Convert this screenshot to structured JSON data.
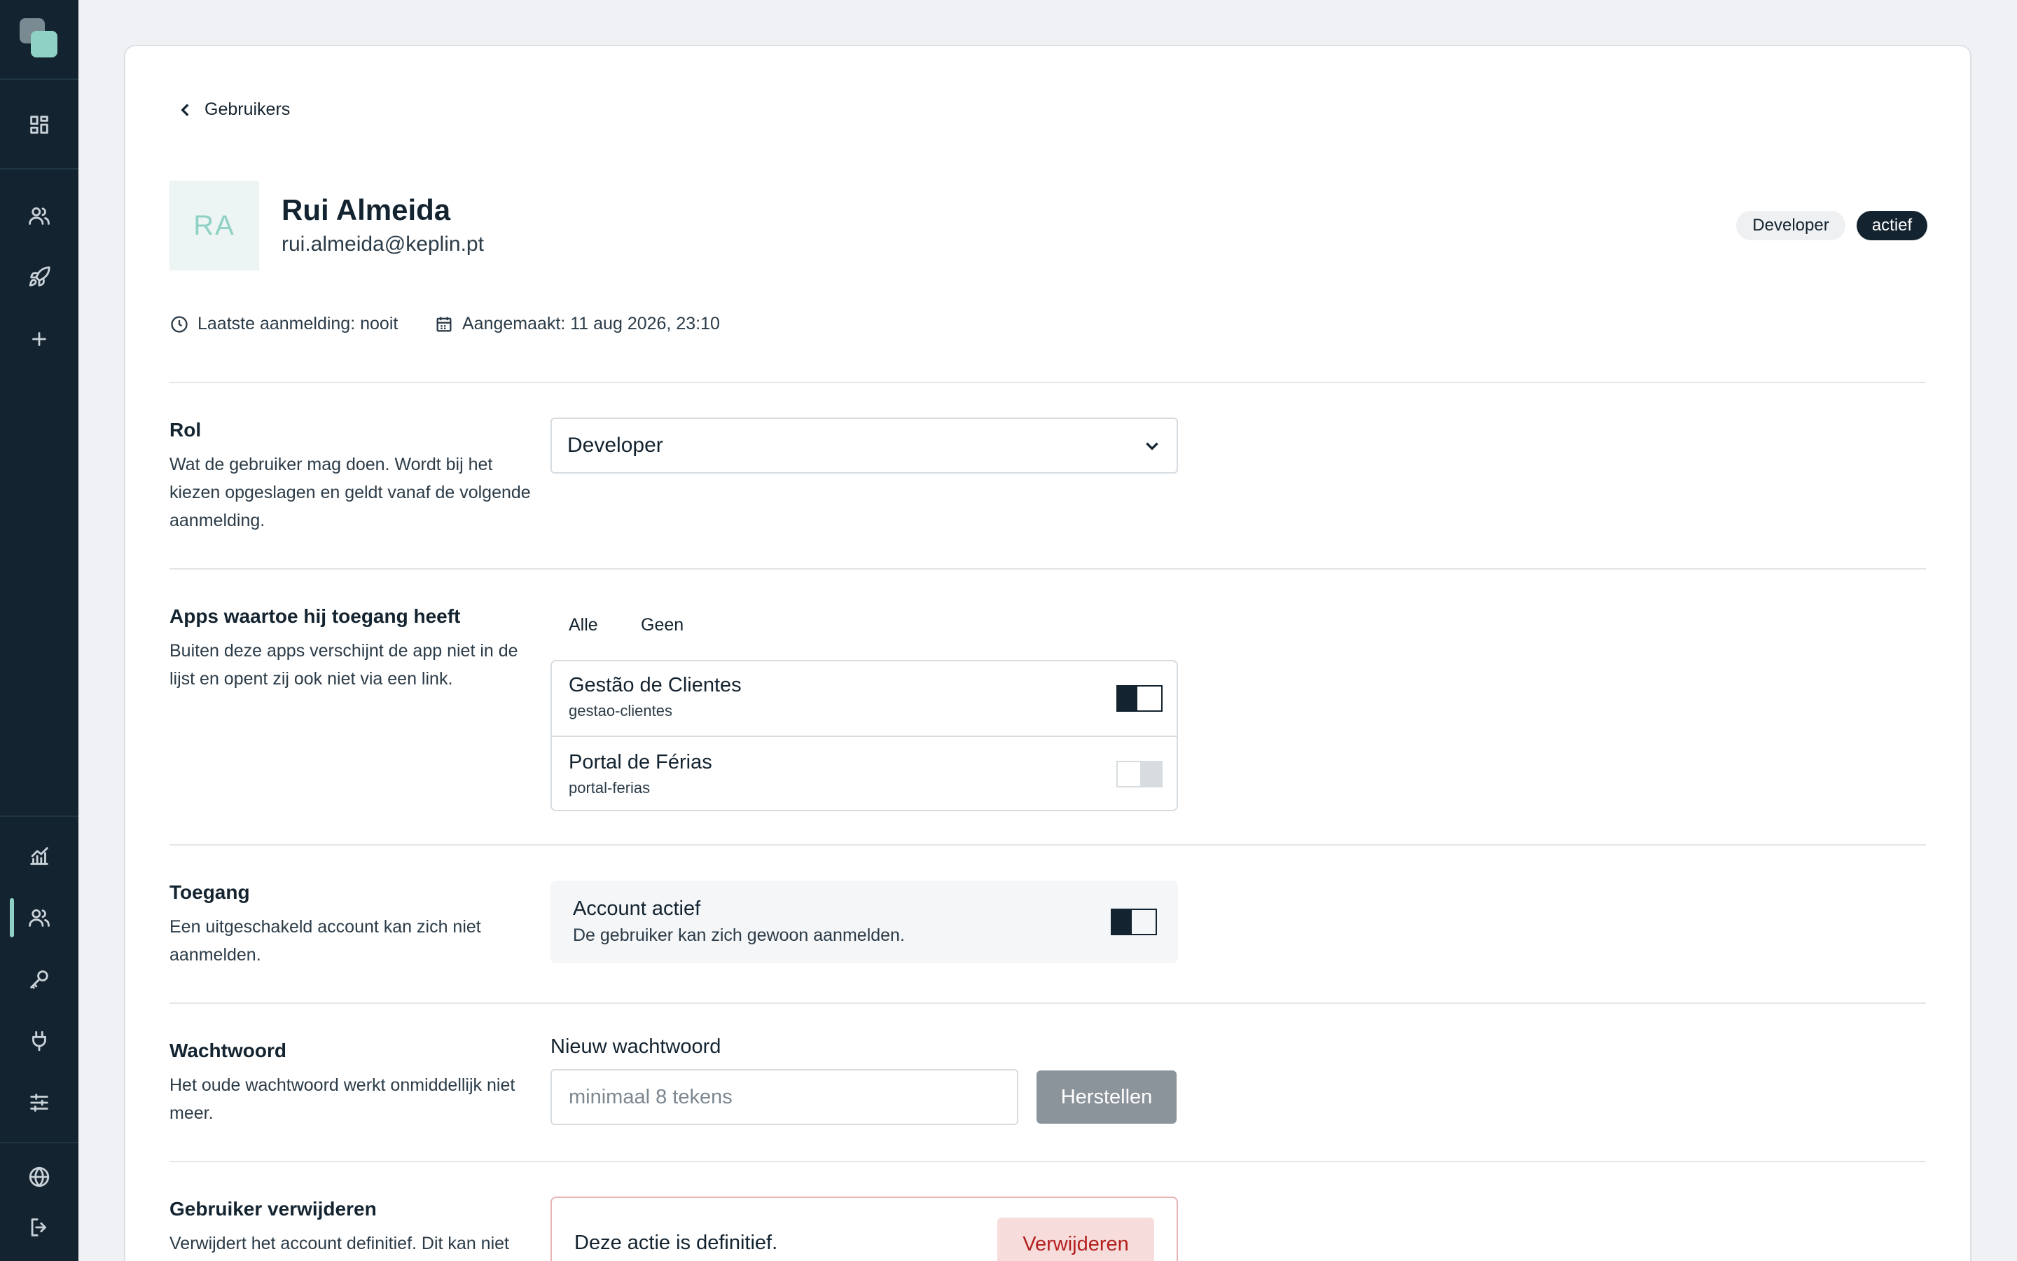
{
  "sidebar": {
    "top_icons": [
      "dashboard-icon",
      "users-icon",
      "rocket-icon",
      "plus-icon"
    ],
    "bottom_icons": [
      "analytics-icon",
      "users-icon",
      "key-icon",
      "plug-icon",
      "sliders-icon",
      "globe-icon",
      "logout-icon"
    ],
    "active_item": "users",
    "accent_color": "#8fd1c4"
  },
  "breadcrumb": {
    "back_label": "Gebruikers"
  },
  "user": {
    "initials": "RA",
    "name": "Rui Almeida",
    "email": "rui.almeida@keplin.pt",
    "role_badge": "Developer",
    "status_badge": "actief"
  },
  "meta": {
    "last_login": "Laatste aanmelding: nooit",
    "created": "Aangemaakt: 11 aug 2026, 23:10"
  },
  "role_section": {
    "title": "Rol",
    "description": "Wat de gebruiker mag doen. Wordt bij het kiezen opgeslagen en geldt vanaf de volgende aanmelding.",
    "selected": "Developer"
  },
  "apps_section": {
    "title": "Apps waartoe hij toegang heeft",
    "description": "Buiten deze apps verschijnt de app niet in de lijst en opent zij ook niet via een link.",
    "all_label": "Alle",
    "none_label": "Geen",
    "apps": [
      {
        "name": "Gestão de Clientes",
        "slug": "gestao-clientes",
        "enabled": true
      },
      {
        "name": "Portal de Férias",
        "slug": "portal-ferias",
        "enabled": false
      }
    ]
  },
  "access_section": {
    "title": "Toegang",
    "description": "Een uitgeschakeld account kan zich niet aanmelden.",
    "toggle_title": "Account actief",
    "toggle_desc": "De gebruiker kan zich gewoon aanmelden.",
    "enabled": true
  },
  "password_section": {
    "title": "Wachtwoord",
    "description": "Het oude wachtwoord werkt onmiddellijk niet meer.",
    "field_label": "Nieuw wachtwoord",
    "placeholder": "minimaal 8 tekens",
    "button_label": "Herstellen"
  },
  "delete_section": {
    "title": "Gebruiker verwijderen",
    "description": "Verwijdert het account definitief. Dit kan niet",
    "warning": "Deze actie is definitief.",
    "button_label": "Verwijderen"
  }
}
